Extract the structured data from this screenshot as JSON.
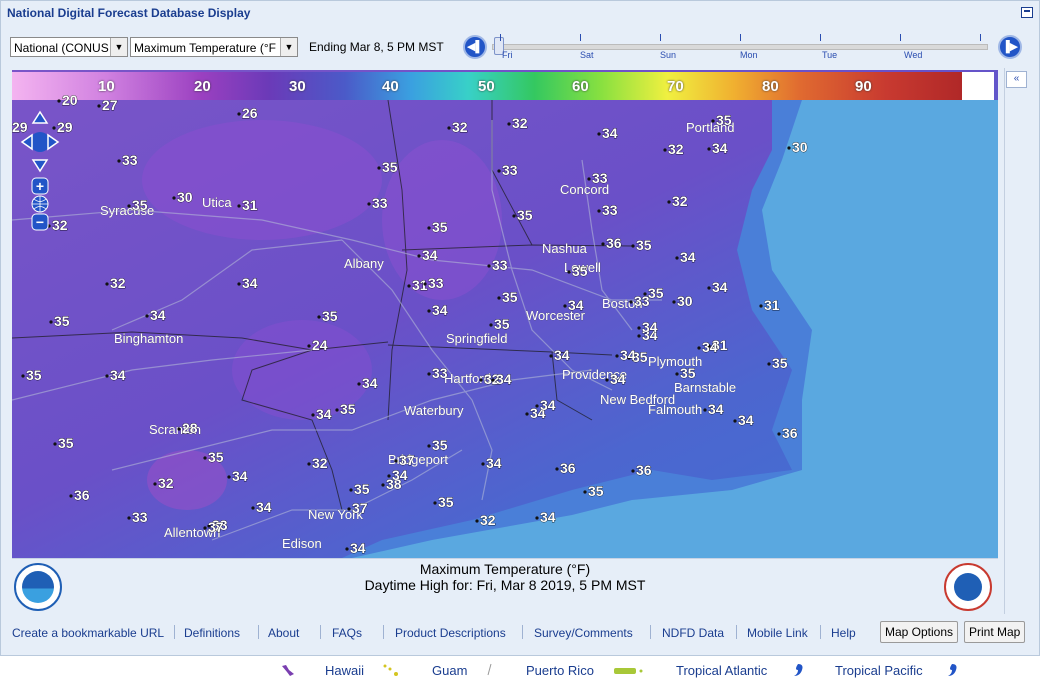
{
  "title": "National Digital Forecast Database Display",
  "controls": {
    "region_select": "National (CONUS",
    "element_select": "Maximum Temperature (°F",
    "ending_label": "Ending Mar  8,   5 PM MST",
    "timeline_days": [
      "Fri",
      "Sat",
      "Sun",
      "Mon",
      "Tue",
      "Wed"
    ]
  },
  "legend": {
    "ticks": [
      "10",
      "20",
      "30",
      "40",
      "50",
      "60",
      "70",
      "80",
      "90"
    ]
  },
  "caption": {
    "line1": "Maximum Temperature (°F)",
    "line2": "Daytime High for: Fri, Mar   8 2019,    5 PM MST"
  },
  "map": {
    "cities": [
      "Syracuse",
      "Utica",
      "Albany",
      "Binghamton",
      "Scranton",
      "Allentown",
      "Edison",
      "New York",
      "Bridgeport",
      "Waterbury",
      "Hartford",
      "Springfield",
      "Worcester",
      "Boston",
      "Lowell",
      "Nashua",
      "Concord",
      "Portland",
      "Providence",
      "Plymouth",
      "Barnstable",
      "New Bedford",
      "Falmouth"
    ],
    "values": [
      "20",
      "27",
      "26",
      "29",
      "29",
      "32",
      "32",
      "34",
      "35",
      "33",
      "34",
      "30",
      "32",
      "30",
      "35",
      "35",
      "33",
      "33",
      "33",
      "32",
      "31",
      "33",
      "32",
      "35",
      "36",
      "35",
      "35",
      "34",
      "35",
      "31",
      "33",
      "34",
      "34",
      "32",
      "34",
      "33",
      "35",
      "34",
      "35",
      "33",
      "31",
      "30",
      "35",
      "34",
      "35",
      "34",
      "35",
      "34",
      "31",
      "24",
      "33",
      "35",
      "34",
      "34",
      "34",
      "34",
      "32",
      "35",
      "34",
      "35",
      "34",
      "34",
      "35",
      "34",
      "35",
      "34",
      "34",
      "34",
      "34",
      "34",
      "35",
      "35",
      "28",
      "35",
      "32",
      "32",
      "34",
      "37",
      "35",
      "34",
      "36",
      "36",
      "36",
      "33",
      "33",
      "37",
      "35",
      "35",
      "32",
      "34",
      "34",
      "36",
      "38",
      "37",
      "34",
      "34",
      "35"
    ],
    "colors": {
      "land_purple": "#7a4fc4",
      "land_blue": "#4f6ad0",
      "ocean": "#5aa8e0",
      "water_light": "#7eb6e8"
    }
  },
  "footer": {
    "links": [
      "Create a bookmarkable URL",
      "Definitions",
      "About",
      "FAQs",
      "Product Descriptions",
      "Survey/Comments",
      "NDFD Data",
      "Mobile Link",
      "Help"
    ],
    "buttons": [
      "Map Options",
      "Print Map"
    ]
  },
  "bottom_links": [
    "Hawaii",
    "Guam",
    "Puerto Rico",
    "Tropical Atlantic",
    "Tropical Pacific"
  ],
  "icons": {
    "prev": "previous-icon",
    "next": "next-icon",
    "collapse": "collapse-icon",
    "noaa": "noaa-logo-icon",
    "nws": "nws-logo-icon"
  }
}
